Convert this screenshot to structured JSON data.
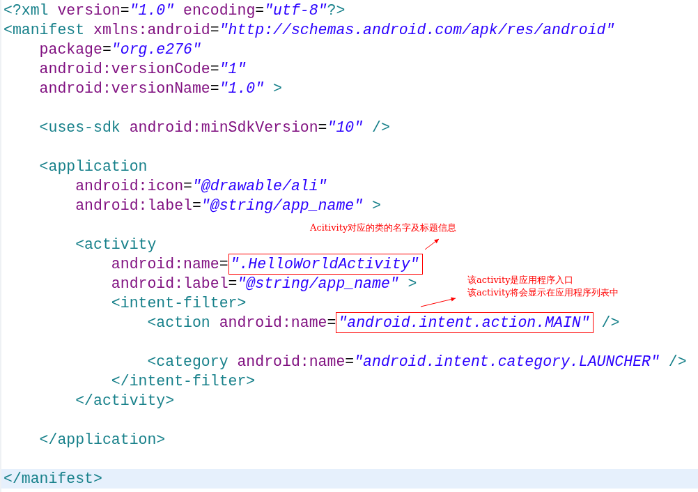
{
  "editor": {
    "lines": [
      {
        "tokens": [
          {
            "kind": "tag",
            "text": "<?xml "
          },
          {
            "kind": "attr",
            "text": "version"
          },
          {
            "kind": "eq",
            "text": "="
          },
          {
            "kind": "value",
            "text": "\"1.0\""
          },
          {
            "kind": "attr",
            "text": " encoding"
          },
          {
            "kind": "eq",
            "text": "="
          },
          {
            "kind": "value",
            "text": "\"utf-8\""
          },
          {
            "kind": "tag",
            "text": "?>"
          }
        ]
      },
      {
        "tokens": [
          {
            "kind": "tag",
            "text": "<manifest "
          },
          {
            "kind": "attr",
            "text": "xmlns:android"
          },
          {
            "kind": "eq",
            "text": "="
          },
          {
            "kind": "value",
            "text": "\"http://schemas.android.com/apk/res/android\""
          }
        ]
      },
      {
        "tokens": [
          {
            "kind": "attr",
            "text": "    package"
          },
          {
            "kind": "eq",
            "text": "="
          },
          {
            "kind": "value",
            "text": "\"org.e276\""
          }
        ]
      },
      {
        "tokens": [
          {
            "kind": "attr",
            "text": "    android:versionCode"
          },
          {
            "kind": "eq",
            "text": "="
          },
          {
            "kind": "value",
            "text": "\"1\""
          }
        ]
      },
      {
        "tokens": [
          {
            "kind": "attr",
            "text": "    android:versionName"
          },
          {
            "kind": "eq",
            "text": "="
          },
          {
            "kind": "value",
            "text": "\"1.0\""
          },
          {
            "kind": "tag",
            "text": " >"
          }
        ]
      },
      {
        "blank": true
      },
      {
        "tokens": [
          {
            "kind": "tag",
            "text": "    <uses-sdk "
          },
          {
            "kind": "attr",
            "text": "android:minSdkVersion"
          },
          {
            "kind": "eq",
            "text": "="
          },
          {
            "kind": "value",
            "text": "\"10\""
          },
          {
            "kind": "tag",
            "text": " />"
          }
        ]
      },
      {
        "blank": true
      },
      {
        "tokens": [
          {
            "kind": "tag",
            "text": "    <application"
          }
        ]
      },
      {
        "tokens": [
          {
            "kind": "attr",
            "text": "        android:icon"
          },
          {
            "kind": "eq",
            "text": "="
          },
          {
            "kind": "value",
            "text": "\"@drawable/ali\""
          }
        ]
      },
      {
        "tokens": [
          {
            "kind": "attr",
            "text": "        android:label"
          },
          {
            "kind": "eq",
            "text": "="
          },
          {
            "kind": "value",
            "text": "\"@string/app_name\""
          },
          {
            "kind": "tag",
            "text": " >"
          }
        ]
      },
      {
        "blank": true
      },
      {
        "tokens": [
          {
            "kind": "tag",
            "text": "        <activity"
          }
        ]
      },
      {
        "tokens": [
          {
            "kind": "attr",
            "text": "            android:name"
          },
          {
            "kind": "eq",
            "text": "="
          },
          {
            "kind": "value",
            "text": "\".HelloWorldActivity\"",
            "boxed": true
          }
        ]
      },
      {
        "tokens": [
          {
            "kind": "attr",
            "text": "            android:label"
          },
          {
            "kind": "eq",
            "text": "="
          },
          {
            "kind": "value",
            "text": "\"@string/app_name\""
          },
          {
            "kind": "tag",
            "text": " >"
          }
        ]
      },
      {
        "tokens": [
          {
            "kind": "tag",
            "text": "            <intent-filter>"
          }
        ]
      },
      {
        "tokens": [
          {
            "kind": "tag",
            "text": "                <action "
          },
          {
            "kind": "attr",
            "text": "android:name"
          },
          {
            "kind": "eq",
            "text": "="
          },
          {
            "kind": "value",
            "text": "\"android.intent.action.MAIN\"",
            "boxed": true
          },
          {
            "kind": "tag",
            "text": " />"
          }
        ]
      },
      {
        "blank": true
      },
      {
        "tokens": [
          {
            "kind": "tag",
            "text": "                <category "
          },
          {
            "kind": "attr",
            "text": "android:name"
          },
          {
            "kind": "eq",
            "text": "="
          },
          {
            "kind": "value",
            "text": "\"android.intent.category.LAUNCHER\""
          },
          {
            "kind": "tag",
            "text": " />"
          }
        ]
      },
      {
        "tokens": [
          {
            "kind": "tag",
            "text": "            </intent-filter>"
          }
        ]
      },
      {
        "tokens": [
          {
            "kind": "tag",
            "text": "        </activity>"
          }
        ]
      },
      {
        "blank": true
      },
      {
        "tokens": [
          {
            "kind": "tag",
            "text": "    </application>"
          }
        ]
      },
      {
        "blank": true
      },
      {
        "tokens": [
          {
            "kind": "tag",
            "text": "</manifest>"
          }
        ],
        "current": true
      }
    ]
  },
  "annotations": [
    {
      "lines": [
        "Acitivity对应的类的名字及标题信息"
      ]
    },
    {
      "lines": [
        "该activity是应用程序入口",
        "该activity将会显示在应用程序列表中"
      ]
    }
  ]
}
